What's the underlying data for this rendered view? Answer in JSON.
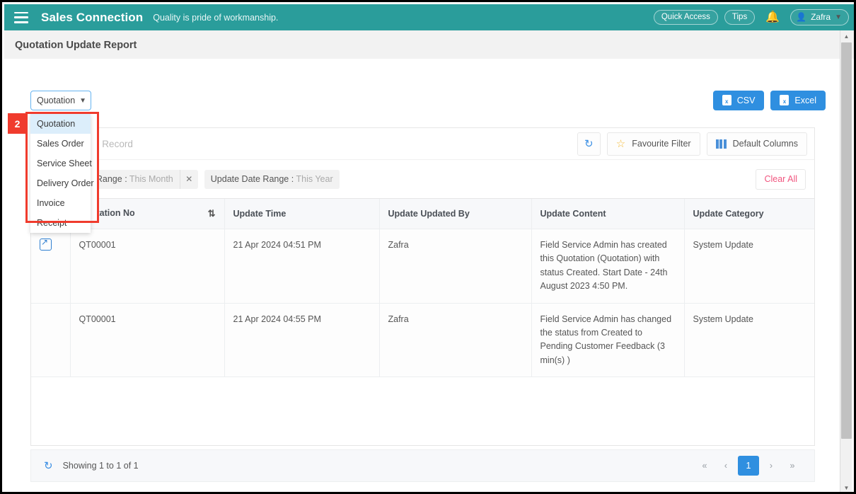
{
  "header": {
    "menu_icon": "hamburger-icon",
    "brand": "Sales Connection",
    "tagline": "Quality is pride of workmanship.",
    "quick_access": "Quick Access",
    "tips": "Tips",
    "bell_icon": "bell-icon",
    "user_name": "Zafra",
    "brand_color": "#2a9d9b"
  },
  "page": {
    "title": "Quotation Update Report"
  },
  "type_select": {
    "value": "Quotation",
    "options": [
      "Quotation",
      "Sales Order",
      "Service Sheet",
      "Delivery Order",
      "Invoice",
      "Receipt"
    ],
    "selected_index": 0
  },
  "annotation": {
    "badge": "2",
    "color": "#f03b2d"
  },
  "export": {
    "csv_label": "CSV",
    "excel_label": "Excel",
    "icon_text": "x",
    "color": "#2f8fe0"
  },
  "search": {
    "placeholder": "Search Table Record",
    "value": "",
    "refresh_icon": "refresh-icon",
    "favourite_filter": "Favourite Filter",
    "default_columns": "Default Columns"
  },
  "filters": {
    "tags": [
      {
        "label": "Create Date Range",
        "value": "This Month",
        "removable": true
      },
      {
        "label": "Update Date Range",
        "value": "This Year",
        "removable": false
      }
    ],
    "clear_all": "Clear All"
  },
  "table": {
    "columns": [
      {
        "label": "#",
        "sortable": false
      },
      {
        "label": "Quotation No",
        "sortable": true
      },
      {
        "label": "Update Time",
        "sortable": false
      },
      {
        "label": "Update Updated By",
        "sortable": false
      },
      {
        "label": "Update Content",
        "sortable": false
      },
      {
        "label": "Update Category",
        "sortable": false
      }
    ],
    "rows": [
      {
        "action_icon": "open-external-icon",
        "quotation_no": "QT00001",
        "update_time": "21 Apr 2024 04:51 PM",
        "updated_by": "Zafra",
        "content": "Field Service Admin has created this Quotation (Quotation) with status Created. Start Date - 24th August 2023 4:50 PM.",
        "category": "System Update"
      },
      {
        "action_icon": "",
        "quotation_no": "QT00001",
        "update_time": "21 Apr 2024 04:55 PM",
        "updated_by": "Zafra",
        "content": "Field Service Admin has changed the status from Created to Pending Customer Feedback (3 min(s) )",
        "category": "System Update"
      }
    ]
  },
  "footer": {
    "refresh_icon": "refresh-icon",
    "showing": "Showing 1 to 1 of 1",
    "pagination": {
      "first": "«",
      "prev": "‹",
      "pages": [
        "1"
      ],
      "current": "1",
      "next": "›",
      "last": "»"
    }
  },
  "scrollbar": {
    "up_arrow": "▲",
    "down_arrow": "▼"
  }
}
